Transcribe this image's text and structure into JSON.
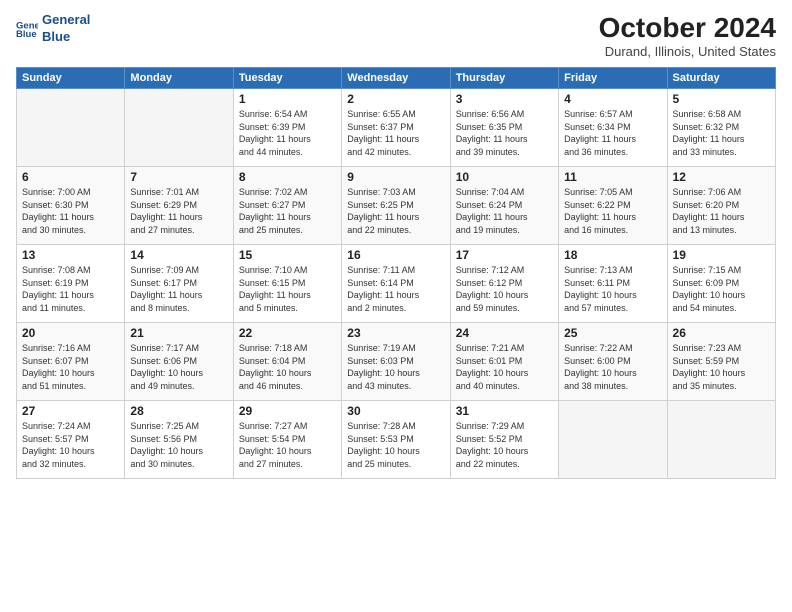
{
  "logo": {
    "line1": "General",
    "line2": "Blue"
  },
  "header": {
    "title": "October 2024",
    "location": "Durand, Illinois, United States"
  },
  "weekdays": [
    "Sunday",
    "Monday",
    "Tuesday",
    "Wednesday",
    "Thursday",
    "Friday",
    "Saturday"
  ],
  "weeks": [
    [
      {
        "day": "",
        "info": ""
      },
      {
        "day": "",
        "info": ""
      },
      {
        "day": "1",
        "info": "Sunrise: 6:54 AM\nSunset: 6:39 PM\nDaylight: 11 hours\nand 44 minutes."
      },
      {
        "day": "2",
        "info": "Sunrise: 6:55 AM\nSunset: 6:37 PM\nDaylight: 11 hours\nand 42 minutes."
      },
      {
        "day": "3",
        "info": "Sunrise: 6:56 AM\nSunset: 6:35 PM\nDaylight: 11 hours\nand 39 minutes."
      },
      {
        "day": "4",
        "info": "Sunrise: 6:57 AM\nSunset: 6:34 PM\nDaylight: 11 hours\nand 36 minutes."
      },
      {
        "day": "5",
        "info": "Sunrise: 6:58 AM\nSunset: 6:32 PM\nDaylight: 11 hours\nand 33 minutes."
      }
    ],
    [
      {
        "day": "6",
        "info": "Sunrise: 7:00 AM\nSunset: 6:30 PM\nDaylight: 11 hours\nand 30 minutes."
      },
      {
        "day": "7",
        "info": "Sunrise: 7:01 AM\nSunset: 6:29 PM\nDaylight: 11 hours\nand 27 minutes."
      },
      {
        "day": "8",
        "info": "Sunrise: 7:02 AM\nSunset: 6:27 PM\nDaylight: 11 hours\nand 25 minutes."
      },
      {
        "day": "9",
        "info": "Sunrise: 7:03 AM\nSunset: 6:25 PM\nDaylight: 11 hours\nand 22 minutes."
      },
      {
        "day": "10",
        "info": "Sunrise: 7:04 AM\nSunset: 6:24 PM\nDaylight: 11 hours\nand 19 minutes."
      },
      {
        "day": "11",
        "info": "Sunrise: 7:05 AM\nSunset: 6:22 PM\nDaylight: 11 hours\nand 16 minutes."
      },
      {
        "day": "12",
        "info": "Sunrise: 7:06 AM\nSunset: 6:20 PM\nDaylight: 11 hours\nand 13 minutes."
      }
    ],
    [
      {
        "day": "13",
        "info": "Sunrise: 7:08 AM\nSunset: 6:19 PM\nDaylight: 11 hours\nand 11 minutes."
      },
      {
        "day": "14",
        "info": "Sunrise: 7:09 AM\nSunset: 6:17 PM\nDaylight: 11 hours\nand 8 minutes."
      },
      {
        "day": "15",
        "info": "Sunrise: 7:10 AM\nSunset: 6:15 PM\nDaylight: 11 hours\nand 5 minutes."
      },
      {
        "day": "16",
        "info": "Sunrise: 7:11 AM\nSunset: 6:14 PM\nDaylight: 11 hours\nand 2 minutes."
      },
      {
        "day": "17",
        "info": "Sunrise: 7:12 AM\nSunset: 6:12 PM\nDaylight: 10 hours\nand 59 minutes."
      },
      {
        "day": "18",
        "info": "Sunrise: 7:13 AM\nSunset: 6:11 PM\nDaylight: 10 hours\nand 57 minutes."
      },
      {
        "day": "19",
        "info": "Sunrise: 7:15 AM\nSunset: 6:09 PM\nDaylight: 10 hours\nand 54 minutes."
      }
    ],
    [
      {
        "day": "20",
        "info": "Sunrise: 7:16 AM\nSunset: 6:07 PM\nDaylight: 10 hours\nand 51 minutes."
      },
      {
        "day": "21",
        "info": "Sunrise: 7:17 AM\nSunset: 6:06 PM\nDaylight: 10 hours\nand 49 minutes."
      },
      {
        "day": "22",
        "info": "Sunrise: 7:18 AM\nSunset: 6:04 PM\nDaylight: 10 hours\nand 46 minutes."
      },
      {
        "day": "23",
        "info": "Sunrise: 7:19 AM\nSunset: 6:03 PM\nDaylight: 10 hours\nand 43 minutes."
      },
      {
        "day": "24",
        "info": "Sunrise: 7:21 AM\nSunset: 6:01 PM\nDaylight: 10 hours\nand 40 minutes."
      },
      {
        "day": "25",
        "info": "Sunrise: 7:22 AM\nSunset: 6:00 PM\nDaylight: 10 hours\nand 38 minutes."
      },
      {
        "day": "26",
        "info": "Sunrise: 7:23 AM\nSunset: 5:59 PM\nDaylight: 10 hours\nand 35 minutes."
      }
    ],
    [
      {
        "day": "27",
        "info": "Sunrise: 7:24 AM\nSunset: 5:57 PM\nDaylight: 10 hours\nand 32 minutes."
      },
      {
        "day": "28",
        "info": "Sunrise: 7:25 AM\nSunset: 5:56 PM\nDaylight: 10 hours\nand 30 minutes."
      },
      {
        "day": "29",
        "info": "Sunrise: 7:27 AM\nSunset: 5:54 PM\nDaylight: 10 hours\nand 27 minutes."
      },
      {
        "day": "30",
        "info": "Sunrise: 7:28 AM\nSunset: 5:53 PM\nDaylight: 10 hours\nand 25 minutes."
      },
      {
        "day": "31",
        "info": "Sunrise: 7:29 AM\nSunset: 5:52 PM\nDaylight: 10 hours\nand 22 minutes."
      },
      {
        "day": "",
        "info": ""
      },
      {
        "day": "",
        "info": ""
      }
    ]
  ]
}
